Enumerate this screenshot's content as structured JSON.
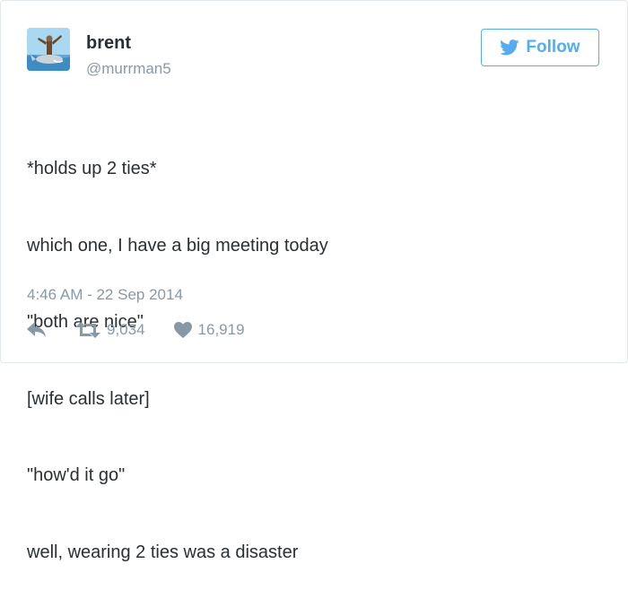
{
  "user": {
    "display_name": "brent",
    "handle": "@murrman5"
  },
  "follow_button": {
    "label": "Follow",
    "icon": "twitter-bird-icon"
  },
  "tweet": {
    "lines": [
      "*holds up 2 ties*",
      "which one, I have a big meeting today",
      "\"both are nice\"",
      "[wife calls later]",
      "\"how'd it go\"",
      "well, wearing 2 ties was a disaster"
    ],
    "timestamp": "4:46 AM - 22 Sep 2014"
  },
  "actions": {
    "reply_icon": "reply-icon",
    "retweet_icon": "retweet-icon",
    "retweet_count": "9,034",
    "like_icon": "heart-icon",
    "like_count": "16,919"
  },
  "colors": {
    "accent": "#55acee",
    "text": "#292f33",
    "muted": "#8899a6",
    "border": "#e1e8ed"
  }
}
